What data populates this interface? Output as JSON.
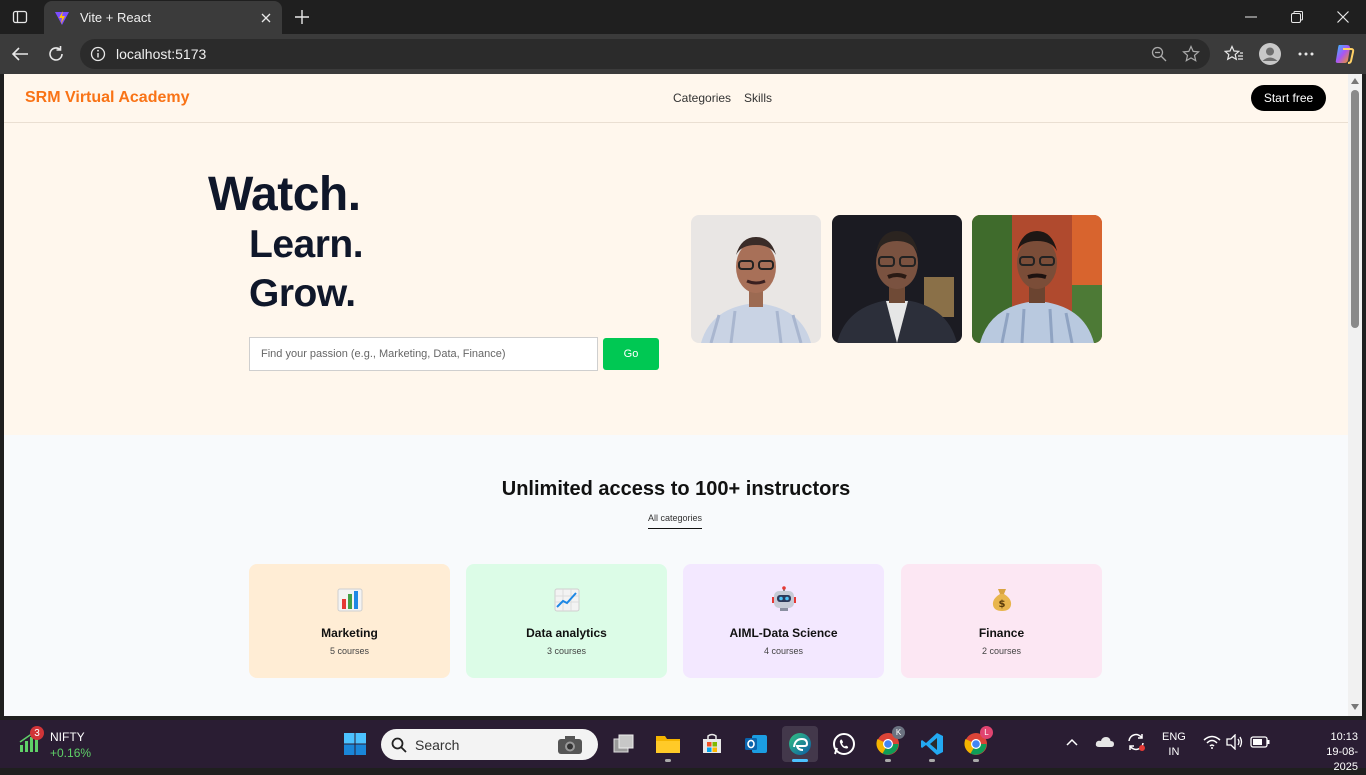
{
  "browser": {
    "tab_title": "Vite + React",
    "url": "localhost:5173"
  },
  "site": {
    "brand": "SRM Virtual Academy",
    "brand_color": "#f97316",
    "nav": [
      "Categories",
      "Skills"
    ],
    "cta": "Start free"
  },
  "hero": {
    "line1": "Watch.",
    "line2": "Learn.",
    "line3": "Grow.",
    "search_placeholder": "Find your passion (e.g., Marketing, Data, Finance)",
    "go_label": "Go",
    "go_color": "#00c853"
  },
  "instructors": {
    "title": "Unlimited access to 100+ instructors",
    "filter_label": "All categories",
    "categories": [
      {
        "name": "Marketing",
        "count": "5 courses",
        "icon": "bar-chart-icon",
        "bg": "#ffedd5"
      },
      {
        "name": "Data analytics",
        "count": "3 courses",
        "icon": "trend-chart-icon",
        "bg": "#dcfce7"
      },
      {
        "name": "AIML-Data Science",
        "count": "4 courses",
        "icon": "robot-icon",
        "bg": "#f3e8ff"
      },
      {
        "name": "Finance",
        "count": "2 courses",
        "icon": "money-bag-icon",
        "bg": "#fce7f3"
      }
    ]
  },
  "taskbar": {
    "ticker_name": "NIFTY",
    "ticker_change": "+0.16%",
    "ticker_badge": "3",
    "search_label": "Search",
    "lang_top": "ENG",
    "lang_bottom": "IN",
    "time": "10:13",
    "date": "19-08-2025"
  }
}
